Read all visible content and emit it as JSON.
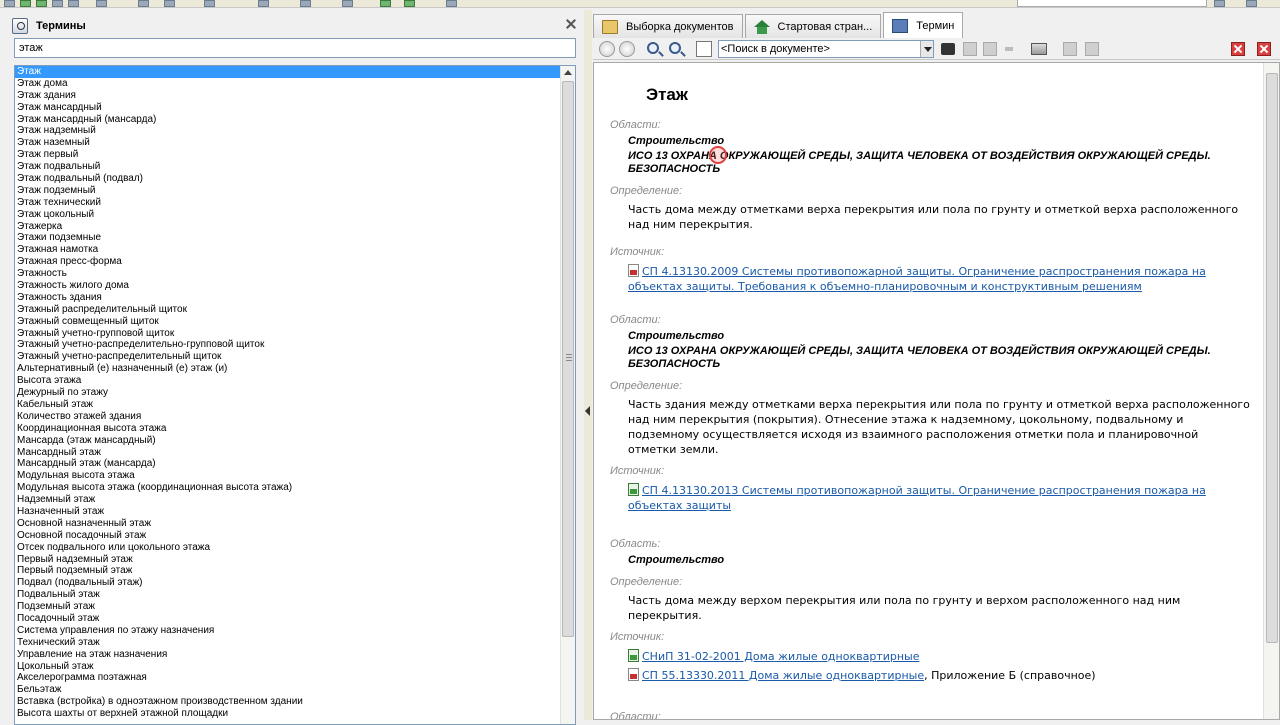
{
  "left_panel": {
    "title": "Термины",
    "search_value": "этаж",
    "terms": [
      "Этаж",
      "Этаж дома",
      "Этаж здания",
      "Этаж мансардный",
      "Этаж мансардный (мансарда)",
      "Этаж надземный",
      "Этаж наземный",
      "Этаж первый",
      "Этаж подвальный",
      "Этаж подвальный (подвал)",
      "Этаж подземный",
      "Этаж технический",
      "Этаж цокольный",
      "Этажерка",
      "Этажи подземные",
      "Этажная намотка",
      "Этажная пресс-форма",
      "Этажность",
      "Этажность жилого дома",
      "Этажность здания",
      "Этажный распределительный щиток",
      "Этажный совмещенный щиток",
      "Этажный учетно-групповой щиток",
      "Этажный учетно-распределительно-групповой щиток",
      "Этажный учетно-распределительный щиток",
      "Альтернативный (е) назначенный (е) этаж (и)",
      "Высота этажа",
      "Дежурный по этажу",
      "Кабельный этаж",
      "Количество этажей здания",
      "Координационная высота этажа",
      "Мансарда (этаж мансардный)",
      "Мансардный этаж",
      "Мансардный этаж (мансарда)",
      "Модульная высота этажа",
      "Модульная высота этажа (координационная высота этажа)",
      "Надземный этаж",
      "Назначенный этаж",
      "Основной назначенный этаж",
      "Основной посадочный этаж",
      "Отсек подвального или цокольного этажа",
      "Первый надземный этаж",
      "Первый подземный этаж",
      "Подвал (подвальный этаж)",
      "Подвальный этаж",
      "Подземный этаж",
      "Посадочный этаж",
      "Система управления по этажу назначения",
      "Технический этаж",
      "Управление на этаж назначения",
      "Цокольный этаж",
      "Акселерограмма поэтажная",
      "Бельэтаж",
      "Вставка (встройка) в одноэтажном производственном здании",
      "Высота шахты от верхней этажной площадки"
    ]
  },
  "right_panel": {
    "tabs": [
      {
        "label": "Выборка документов",
        "icon": "folder-icon"
      },
      {
        "label": "Стартовая стран...",
        "icon": "home-icon"
      },
      {
        "label": "Термин",
        "icon": "book-icon"
      }
    ],
    "doc_search_placeholder": "<Поиск в документе>",
    "term_title": "Этаж",
    "entries": [
      {
        "area_label": "Области:",
        "areas": [
          "Строительство",
          "ИСО 13 ОХРАНА ОКРУЖАЮЩЕЙ СРЕДЫ, ЗАЩИТА ЧЕЛОВЕКА ОТ ВОЗДЕЙСТВИЯ ОКРУЖАЮЩЕЙ СРЕДЫ. БЕЗОПАСНОСТЬ"
        ],
        "def_label": "Определение:",
        "definition": "Часть дома между отметками верха перекрытия или пола по грунту и отметкой верха расположенного над ним перекрытия.",
        "src_label": "Источник:",
        "sources": [
          {
            "icon": "pdf-icon",
            "text": "СП 4.13130.2009 Системы противопожарной защиты. Ограничение распространения пожара на объектах защиты. Требования к объемно-планировочным и конструктивным решениям",
            "suffix": ""
          }
        ]
      },
      {
        "area_label": "Области:",
        "areas": [
          "Строительство",
          "ИСО 13 ОХРАНА ОКРУЖАЮЩЕЙ СРЕДЫ, ЗАЩИТА ЧЕЛОВЕКА ОТ ВОЗДЕЙСТВИЯ ОКРУЖАЮЩЕЙ СРЕДЫ. БЕЗОПАСНОСТЬ"
        ],
        "def_label": "Определение:",
        "definition": "Часть здания между отметками верха перекрытия или пола по грунту и отметкой верха расположенного над ним перекрытия (покрытия). Отнесение этажа к надземному, цокольному, подвальному и подземному осуществляется исходя из взаимного расположения отметки пола и планировочной отметки земли.",
        "src_label": "Источник:",
        "sources": [
          {
            "icon": "doc-icon",
            "text": "СП 4.13130.2013 Системы противопожарной защиты. Ограничение распространения пожара на объектах защиты",
            "suffix": ""
          }
        ]
      },
      {
        "area_label": "Область:",
        "areas": [
          "Строительство"
        ],
        "def_label": "Определение:",
        "definition": "Часть дома между верхом перекрытия или пола по грунту и верхом расположенного над ним перекрытия.",
        "src_label": "Источник:",
        "sources": [
          {
            "icon": "doc-icon",
            "text": "СНиП 31-02-2001 Дома жилые одноквартирные",
            "suffix": ""
          },
          {
            "icon": "pdf-icon",
            "text": "СП 55.13330.2011 Дома жилые одноквартирные",
            "suffix": ", Приложение Б (справочное)"
          }
        ]
      }
    ],
    "footer_label": "Области:"
  }
}
